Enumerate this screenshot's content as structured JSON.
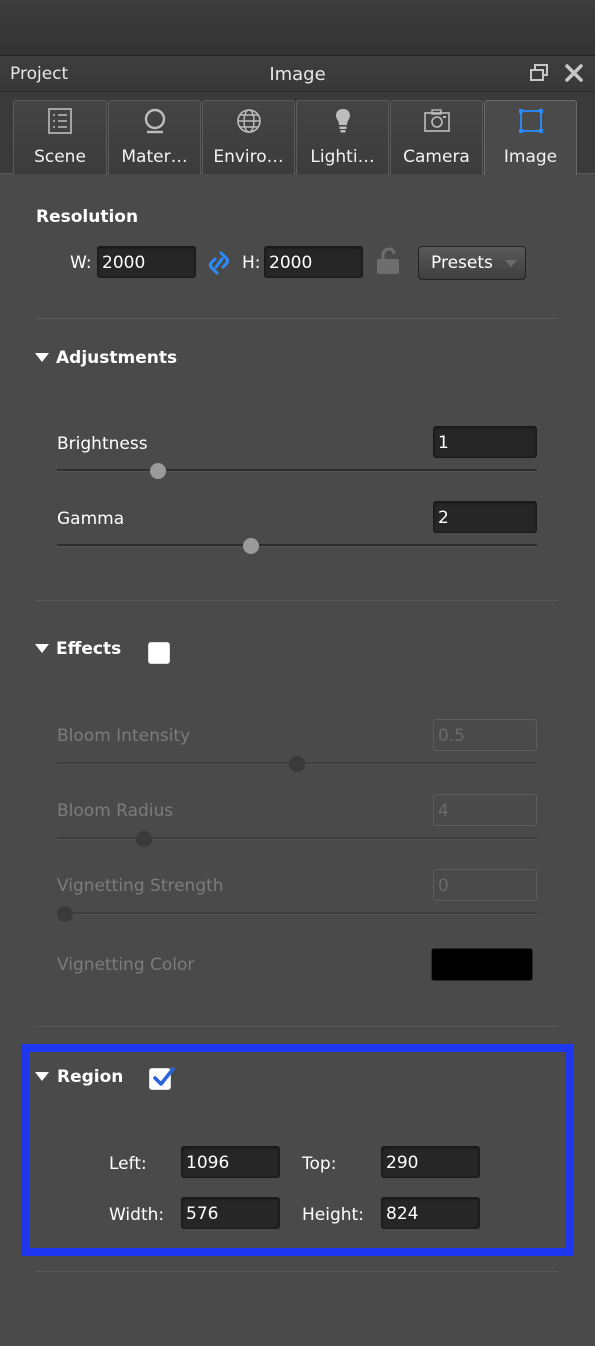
{
  "titlebar": {
    "left_label": "Project",
    "title": "Image"
  },
  "tabs": [
    {
      "label": "Scene",
      "icon": "list-icon"
    },
    {
      "label": "Mater…",
      "icon": "material-sphere-icon"
    },
    {
      "label": "Enviro…",
      "icon": "globe-icon"
    },
    {
      "label": "Lighti…",
      "icon": "lightbulb-icon"
    },
    {
      "label": "Camera",
      "icon": "camera-icon"
    },
    {
      "label": "Image",
      "icon": "crop-frame-icon",
      "active": true
    }
  ],
  "resolution": {
    "title": "Resolution",
    "w_label": "W:",
    "w_value": "2000",
    "h_label": "H:",
    "h_value": "2000",
    "presets_label": "Presets"
  },
  "adjustments": {
    "title": "Adjustments",
    "brightness": {
      "label": "Brightness",
      "value": "1",
      "slider_fraction": 0.2
    },
    "gamma": {
      "label": "Gamma",
      "value": "2",
      "slider_fraction": 0.4
    }
  },
  "effects": {
    "title": "Effects",
    "enabled": false,
    "bloom_intensity": {
      "label": "Bloom Intensity",
      "value": "0.5",
      "slider_fraction": 0.5
    },
    "bloom_radius": {
      "label": "Bloom Radius",
      "value": "4",
      "slider_fraction": 0.17
    },
    "vignetting_strength": {
      "label": "Vignetting Strength",
      "value": "0",
      "slider_fraction": 0.0
    },
    "vignetting_color": {
      "label": "Vignetting Color",
      "color": "#000000"
    }
  },
  "region": {
    "title": "Region",
    "enabled": true,
    "left_label": "Left:",
    "left_value": "1096",
    "top_label": "Top:",
    "top_value": "290",
    "width_label": "Width:",
    "width_value": "576",
    "height_label": "Height:",
    "height_value": "824"
  },
  "colors": {
    "accent": "#1f36f0",
    "link_icon": "#2a8cff",
    "panel_bg": "#4a4a4a"
  }
}
